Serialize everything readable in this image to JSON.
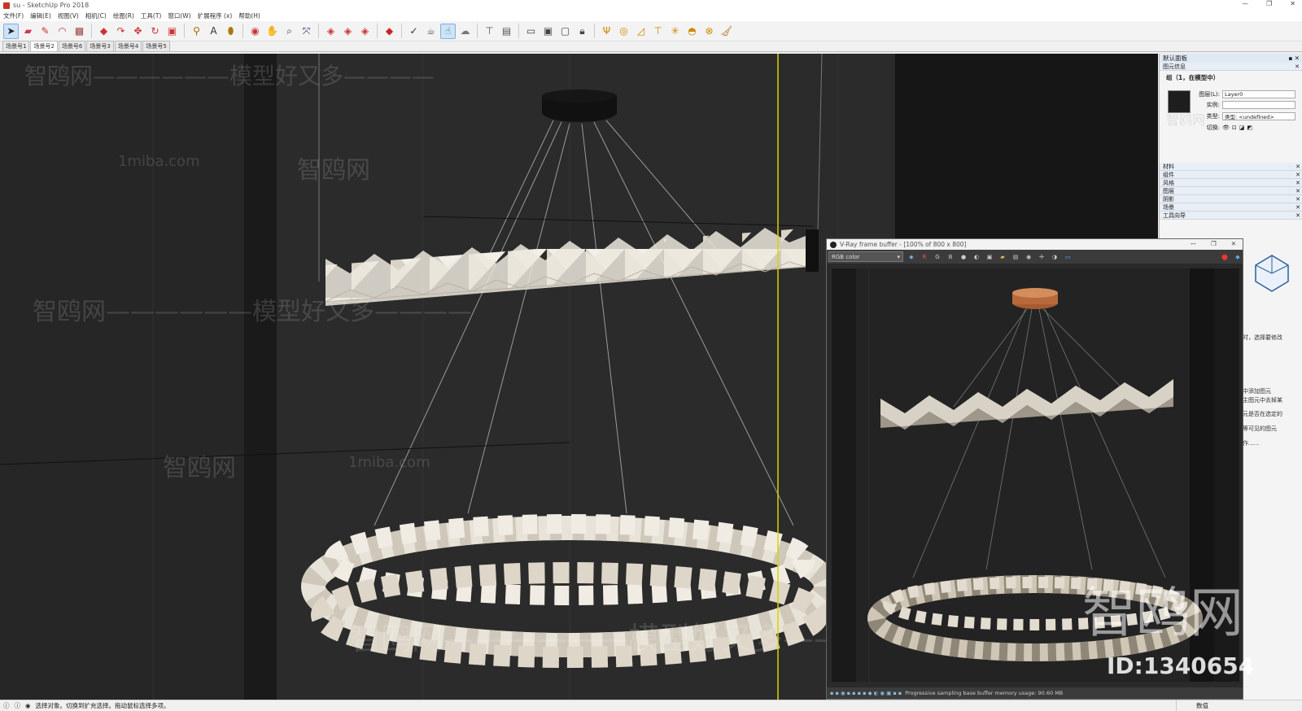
{
  "window": {
    "title": "su - SketchUp Pro 2018",
    "controls": [
      "—",
      "❐",
      "✕"
    ]
  },
  "menu": [
    "文件(F)",
    "编辑(E)",
    "视图(V)",
    "相机(C)",
    "绘图(R)",
    "工具(T)",
    "窗口(W)",
    "扩展程序 (x)",
    "帮助(H)"
  ],
  "toolbar_icons": [
    "select-icon",
    "eraser-icon",
    "pencil-icon",
    "arc-icon",
    "rectangle-icon",
    "pushpull-icon",
    "followme-icon",
    "move-icon",
    "rotate-icon",
    "scale-icon",
    "tape-icon",
    "text-icon",
    "paint-icon",
    "orbit-icon",
    "pan-icon",
    "zoom-icon",
    "zoom-extents-icon",
    "section-icon",
    "component-icon",
    "group-icon",
    "ruby-icon",
    "check-icon",
    "teapot-icon",
    "hand-icon",
    "cloud-icon",
    "ground-icon",
    "axis-icon",
    "window1-icon",
    "window2-icon",
    "window3-icon",
    "lock-icon",
    "lamp-icon",
    "sun-icon",
    "protractor-icon",
    "dimension-icon",
    "sparkle-icon",
    "dome-icon",
    "hat-icon",
    "broom-icon"
  ],
  "scenes": [
    "场景号1",
    "场景号2",
    "场景号6",
    "场景号3",
    "场景号4",
    "场景号5"
  ],
  "active_scene": 1,
  "tray": {
    "title": "默认面板",
    "entity_section": "图元信息",
    "entity_name": "组（1，在模型中）",
    "layer_label": "图层(L):",
    "layer_value": "Layer0",
    "instance_label": "实例:",
    "instance_value": "",
    "type_label": "类型:",
    "type_value": "类型: <undefined>",
    "toggle_label": "切换:",
    "sections": [
      "材料",
      "组件",
      "风格",
      "图层",
      "阴影",
      "场景",
      "工具向导"
    ],
    "instructor_lines": [
      "时，选择要修改",
      "中添加图元",
      "主图元中去掉某",
      "元是否在选定的",
      "等可见的图元",
      "作......"
    ]
  },
  "vfb": {
    "title": "V-Ray frame buffer - [100% of 800 x 800]",
    "channel": "RGB color",
    "channel_buttons": [
      "R",
      "G",
      "B"
    ],
    "status": "Progressive sampling base buffer memory usage: 90.60 MB"
  },
  "status": {
    "text": "选择对象。切换到扩充选择。拖动鼠标选择多项。",
    "measure_label": "数值"
  },
  "watermarks": {
    "site": "智鸥网",
    "slogan": "智鸥网——————模型好又多————",
    "domain": "1miba.com",
    "id": "ID:1340654",
    "brand_large": "智鸥网"
  },
  "colors": {
    "viewport_bg": "#1e1e1e",
    "guide_line": "#d9d300",
    "ring_fill": "#ebe6dc",
    "vfb_bg": "#151515"
  }
}
